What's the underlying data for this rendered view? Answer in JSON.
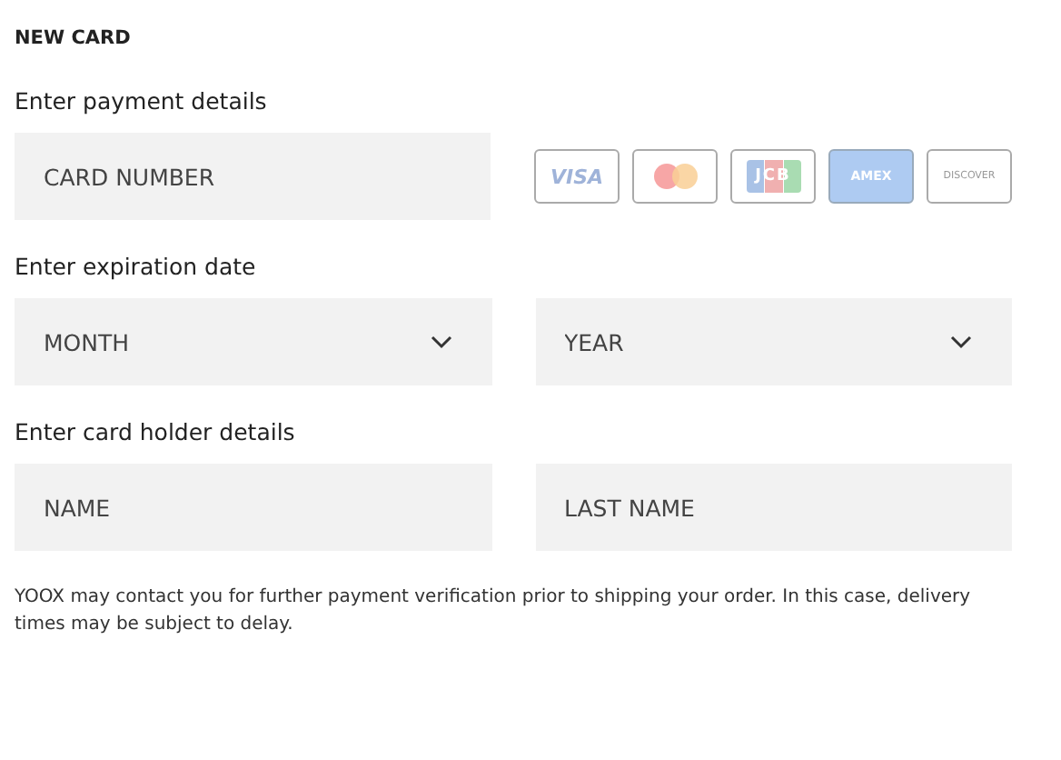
{
  "heading": "NEW CARD",
  "payment": {
    "label": "Enter payment details",
    "card_number": {
      "placeholder": "CARD NUMBER"
    },
    "cards": [
      {
        "kind": "text",
        "label": "VISA",
        "selected": false
      },
      {
        "kind": "circles",
        "selected": false
      },
      {
        "kind": "jcb",
        "label": "JCB",
        "selected": false
      },
      {
        "kind": "text",
        "label": "AMEX",
        "selected": true
      },
      {
        "kind": "text",
        "label": "DISCOVER",
        "selected": false
      }
    ]
  },
  "expiration": {
    "label": "Enter expiration date",
    "fields": [
      {
        "placeholder": "MONTH"
      },
      {
        "placeholder": "YEAR"
      }
    ]
  },
  "holder": {
    "label": "Enter card holder details",
    "fields": [
      {
        "placeholder": "NAME"
      },
      {
        "placeholder": "LAST NAME"
      }
    ]
  },
  "note": "YOOX may contact you for further payment verification prior to shipping your order. In this case, delivery times may be subject to delay."
}
